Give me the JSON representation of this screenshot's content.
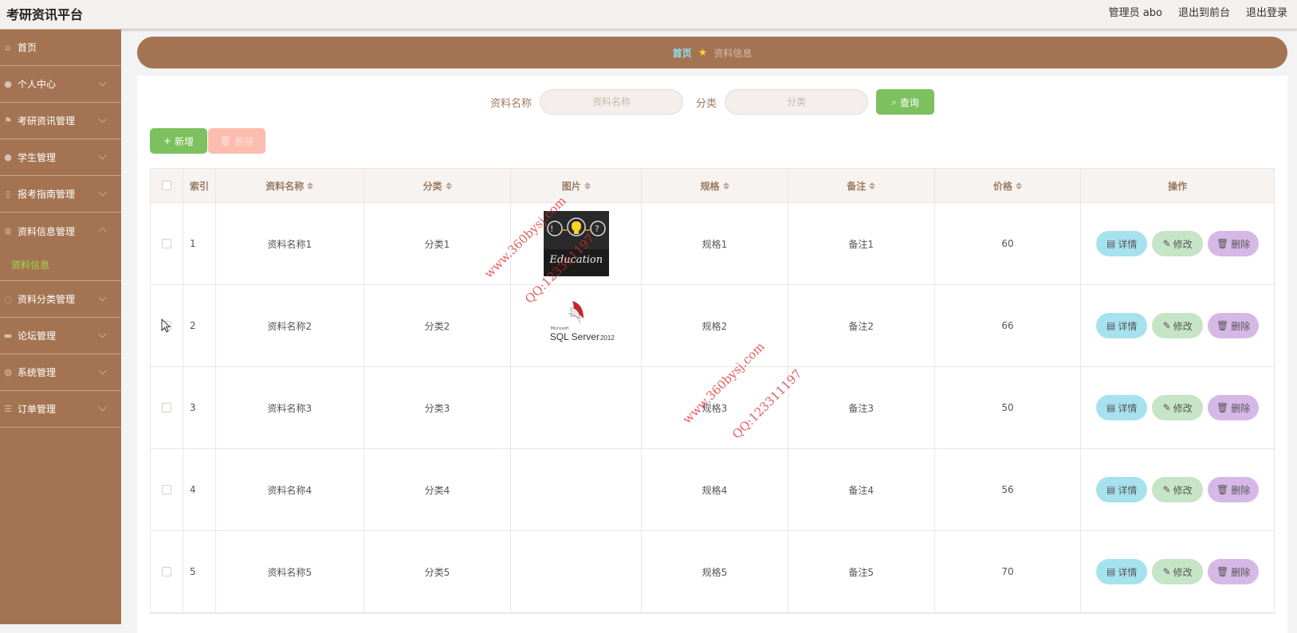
{
  "app": {
    "title": "考研资讯平台"
  },
  "header": {
    "user": "管理员 abo",
    "to_front": "退出到前台",
    "logout": "退出登录"
  },
  "sidebar": {
    "items": [
      {
        "label": "首页",
        "icon": "home-icon"
      },
      {
        "label": "个人中心",
        "icon": "user-icon"
      },
      {
        "label": "考研资讯管理",
        "icon": "flag-icon"
      },
      {
        "label": "学生管理",
        "icon": "person-icon"
      },
      {
        "label": "报考指南管理",
        "icon": "phone-icon"
      },
      {
        "label": "资料信息管理",
        "icon": "list-icon"
      },
      {
        "label": "资料分类管理",
        "icon": "power-icon"
      },
      {
        "label": "论坛管理",
        "icon": "monitor-icon"
      },
      {
        "label": "系统管理",
        "icon": "globe-icon"
      },
      {
        "label": "订单管理",
        "icon": "menu-icon"
      }
    ],
    "sub_item": "资料信息",
    "accent": "#9cd94a",
    "bg": "#a47452"
  },
  "breadcrumb": {
    "home": "首页",
    "current": "资料信息"
  },
  "search": {
    "name_label": "资料名称",
    "name_placeholder": "资料名称",
    "cat_label": "分类",
    "cat_placeholder": "分类",
    "query_button": "查询"
  },
  "toolbar": {
    "add": "新增",
    "delete": "删除"
  },
  "table": {
    "headers": {
      "index": "索引",
      "name": "资料名称",
      "category": "分类",
      "image": "图片",
      "spec": "规格",
      "note": "备注",
      "price": "价格",
      "ops": "操作"
    },
    "rows": [
      {
        "index": "1",
        "name": "资料名称1",
        "category": "分类1",
        "spec": "规格1",
        "note": "备注1",
        "price": "60",
        "image": "education"
      },
      {
        "index": "2",
        "name": "资料名称2",
        "category": "分类2",
        "spec": "规格2",
        "note": "备注2",
        "price": "66",
        "image": "sqlserver"
      },
      {
        "index": "3",
        "name": "资料名称3",
        "category": "分类3",
        "spec": "规格3",
        "note": "备注3",
        "price": "50",
        "image": ""
      },
      {
        "index": "4",
        "name": "资料名称4",
        "category": "分类4",
        "spec": "规格4",
        "note": "备注4",
        "price": "56",
        "image": ""
      },
      {
        "index": "5",
        "name": "资料名称5",
        "category": "分类5",
        "spec": "规格5",
        "note": "备注5",
        "price": "70",
        "image": ""
      }
    ],
    "ops": {
      "detail": "详情",
      "edit": "修改",
      "delete": "删除"
    }
  },
  "images": {
    "education_text": "Education",
    "sql_brand": "Microsoft",
    "sql_text": "SQL Server",
    "sql_version": "2012"
  },
  "watermark": {
    "site": "www.360bysj.com",
    "qq": "QQ:123311197"
  }
}
